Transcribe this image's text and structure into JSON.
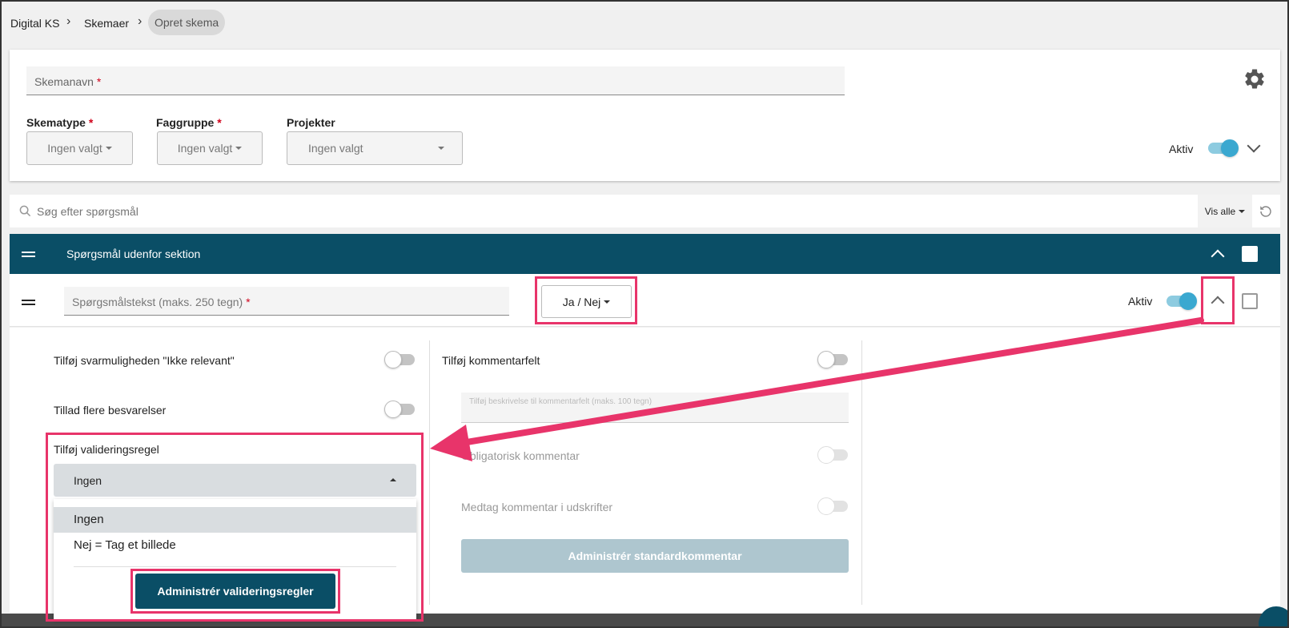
{
  "breadcrumb": {
    "item1": "Digital KS",
    "item2": "Skemaer",
    "current": "Opret skema"
  },
  "form": {
    "name_placeholder": "Skemanavn",
    "required_mark": "*",
    "skematype_label": "Skematype",
    "skematype_value": "Ingen valgt",
    "faggruppe_label": "Faggruppe",
    "faggruppe_value": "Ingen valgt",
    "projekter_label": "Projekter",
    "projekter_value": "Ingen valgt",
    "aktiv_label": "Aktiv"
  },
  "search": {
    "placeholder": "Søg efter spørgsmål",
    "filter_label": "Vis alle"
  },
  "section": {
    "title": "Spørgsmål udenfor sektion"
  },
  "question": {
    "text_placeholder": "Spørgsmålstekst (maks. 250 tegn)",
    "type_label": "Ja / Nej",
    "aktiv_label": "Aktiv"
  },
  "options_left": {
    "ikke_relevant": "Tilføj svarmuligheden \"Ikke relevant\"",
    "flere_besvarelser": "Tillad flere besvarelser",
    "validering_label": "Tilføj valideringsregel",
    "validering_value": "Ingen",
    "dropdown_items": [
      "Ingen",
      "Nej = Tag et billede"
    ],
    "manage_button": "Administrér valideringsregler"
  },
  "options_right": {
    "kommentarfelt": "Tilføj kommentarfelt",
    "kommentar_desc_placeholder": "Tilføj beskrivelse til kommentarfelt (maks. 100 tegn)",
    "obligatorisk": "Obligatorisk kommentar",
    "medtag": "Medtag kommentar i udskrifter",
    "standard_button": "Administrér standardkommentar"
  },
  "colors": {
    "primary": "#0a4e66",
    "accent_toggle": "#3aa8d0",
    "highlight": "#e8346a",
    "required": "#d0021b"
  }
}
